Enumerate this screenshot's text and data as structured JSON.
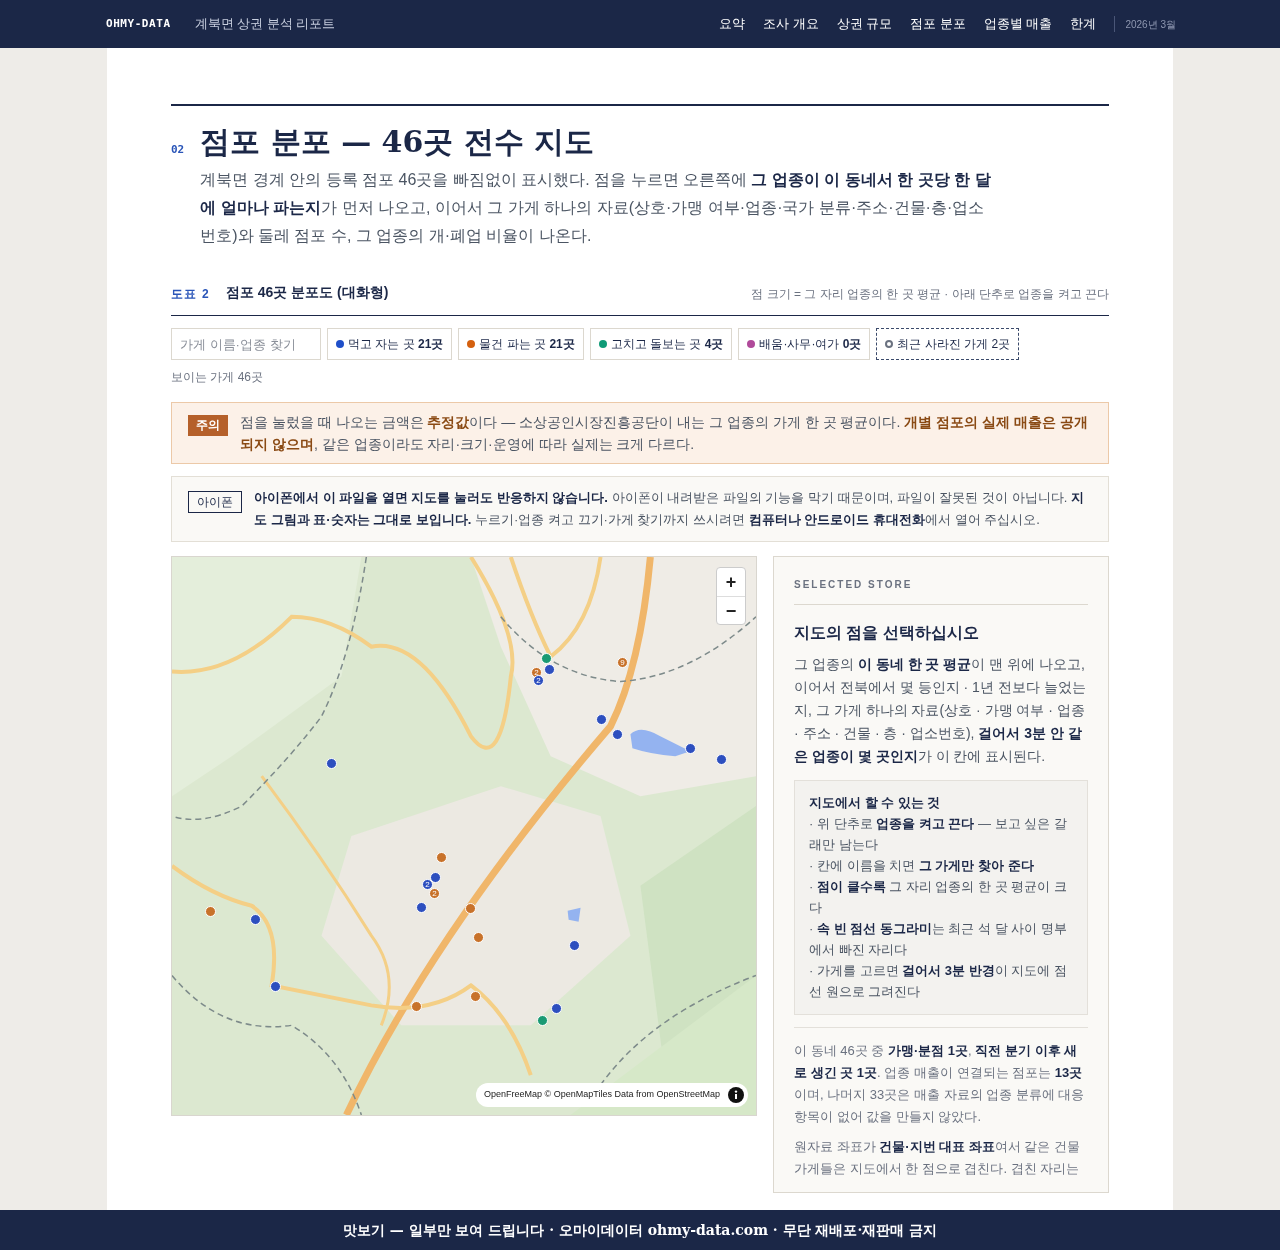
{
  "header": {
    "brand": "OHMY-DATA",
    "subtitle": "계북면 상권 분석 리포트",
    "nav": [
      "요약",
      "조사 개요",
      "상권 규모",
      "점포 분포",
      "업종별 매출",
      "한계"
    ],
    "date": "2026년 3월"
  },
  "section": {
    "number": "02",
    "title": "점포 분포 — 46곳 전수 지도",
    "intro": "계북면 경계 안의 등록 점포 46곳을 빠짐없이 표시했다. 점을 누르면 오른쪽에 **그 업종이 이 동네서 한 곳당 한 달에 얼마나 파는지**가 먼저 나오고, 이어서 그 가게 하나의 자료(상호·가맹 여부·업종·국가 분류·주소·건물·층·업소 번호)와 둘레 점포 수, 그 업종의 개·폐업 비율이 나온다."
  },
  "figure": {
    "label": "도표 2",
    "title": "점포 46곳 분포도 (대화형)",
    "note": "점 크기 = 그 자리 업종의 한 곳 평균 · 아래 단추로 업종을 켜고 끈다"
  },
  "search": {
    "placeholder": "가게 이름·업종 찾기"
  },
  "filters": [
    {
      "kind": "category",
      "label": "먹고 자는 곳 **21곳**",
      "color": "#1f4fc9",
      "on": true
    },
    {
      "kind": "category",
      "label": "물건 파는 곳 **21곳**",
      "color": "#d4600f",
      "on": true
    },
    {
      "kind": "category",
      "label": "고치고 돌보는 곳 **4곳**",
      "color": "#0f9b77",
      "on": true
    },
    {
      "kind": "category",
      "label": "배움·사무·여가 **0곳**",
      "color": "#b04a9a",
      "on": true
    },
    {
      "kind": "closed",
      "label": "최근 사라진 가게 2곳",
      "color": "#6b7280",
      "on": true
    }
  ],
  "visible_count": "보이는 가게 46곳",
  "notice": {
    "badge": "주의",
    "text": "점을 눌렀을 때 나오는 금액은 **추정값**이다 — 소상공인시장진흥공단이 내는 그 업종의 가게 한 곳 평균이다. **개별 점포의 실제 매출은 공개되지 않으며**, 같은 업종이라도 자리·크기·운영에 따라 실제는 크게 다르다."
  },
  "iphone_notice": {
    "badge": "아이폰",
    "text": "**아이폰에서 이 파일을 열면 지도를 눌러도 반응하지 않습니다.** 아이폰이 내려받은 파일의 기능을 막기 때문이며, 파일이 잘못된 것이 아닙니다. **지도 그림과 표·숫자는 그대로 보입니다.** 누르기·업종 켜고 끄기·가게 찾기까지 쓰시려면 **컴퓨터나 안드로이드 휴대전화**에서 열어 주십시오."
  },
  "map": {
    "zoom_in": "+",
    "zoom_out": "−",
    "attribution": "OpenFreeMap © OpenMapTiles Data from OpenStreetMap",
    "markers": [
      {
        "color": "#1a9a73"
      },
      {
        "color": "#2d4fbf"
      },
      {
        "color": "#c8722a",
        "count": "2"
      },
      {
        "color": "#2d4fbf",
        "count": "2"
      },
      {
        "color": "#c8722a",
        "count": "9"
      },
      {
        "color": "#2d4fbf"
      },
      {
        "color": "#2d4fbf"
      },
      {
        "color": "#2d4fbf"
      },
      {
        "color": "#2d4fbf"
      },
      {
        "color": "#2d4fbf"
      },
      {
        "color": "#c8722a"
      },
      {
        "color": "#2d4fbf"
      },
      {
        "color": "#2d4fbf",
        "count": "2"
      },
      {
        "color": "#c8722a",
        "count": "2"
      },
      {
        "color": "#2d4fbf"
      },
      {
        "color": "#c8722a"
      },
      {
        "color": "#c8722a"
      },
      {
        "color": "#2d4fbf"
      },
      {
        "color": "#c8722a"
      },
      {
        "color": "#2d4fbf"
      },
      {
        "color": "#2d4fbf"
      },
      {
        "color": "#c8722a"
      },
      {
        "color": "#c8722a"
      },
      {
        "color": "#1a9a73"
      },
      {
        "color": "#2d4fbf"
      }
    ]
  },
  "panel": {
    "eyebrow": "SELECTED STORE",
    "heading": "지도의 점을 선택하십시오",
    "body": "그 업종의 **이 동네 한 곳 평균**이 맨 위에 나오고, 이어서 전북에서 몇 등인지 · 1년 전보다 늘었는지, 그 가게 하나의 자료(상호 · 가맹 여부 · 업종 · 주소 · 건물 · 층 · 업소번호), **걸어서 3분 안 같은 업종이 몇 곳인지**가 이 칸에 표시된다.",
    "tips_title": "지도에서 할 수 있는 것",
    "tips": [
      "· 위 단추로 **업종을 켜고 끈다** — 보고 싶은 갈래만 남는다",
      "· 칸에 이름을 치면 **그 가게만 찾아 준다**",
      "· **점이 클수록** 그 자리 업종의 한 곳 평균이 크다",
      "· **속 빈 점선 동그라미**는 최근 석 달 사이 명부에서 빠진 자리다",
      "· 가게를 고르면 **걸어서 3분 반경**이 지도에 점선 원으로 그려진다"
    ],
    "summary": "이 동네 46곳 중 **가맹·분점 1곳**, **직전 분기 이후 새로 생긴 곳 1곳**. 업종 매출이 연결되는 점포는 **13곳**이며, 나머지 33곳은 매출 자료의 업종 분류에 대응 항목이 없어 값을 만들지 않았다.",
    "note": "원자료 좌표가 **건물·지번 대표 좌표**여서 같은 건물 가게들은 지도에서 한 점으로 겹친다. 겹친 자리는"
  },
  "footer": "맛보기 — 일부만 보여 드립니다 · 오마이데이터 ohmy-data.com · 무단 재배포·재판매 금지"
}
